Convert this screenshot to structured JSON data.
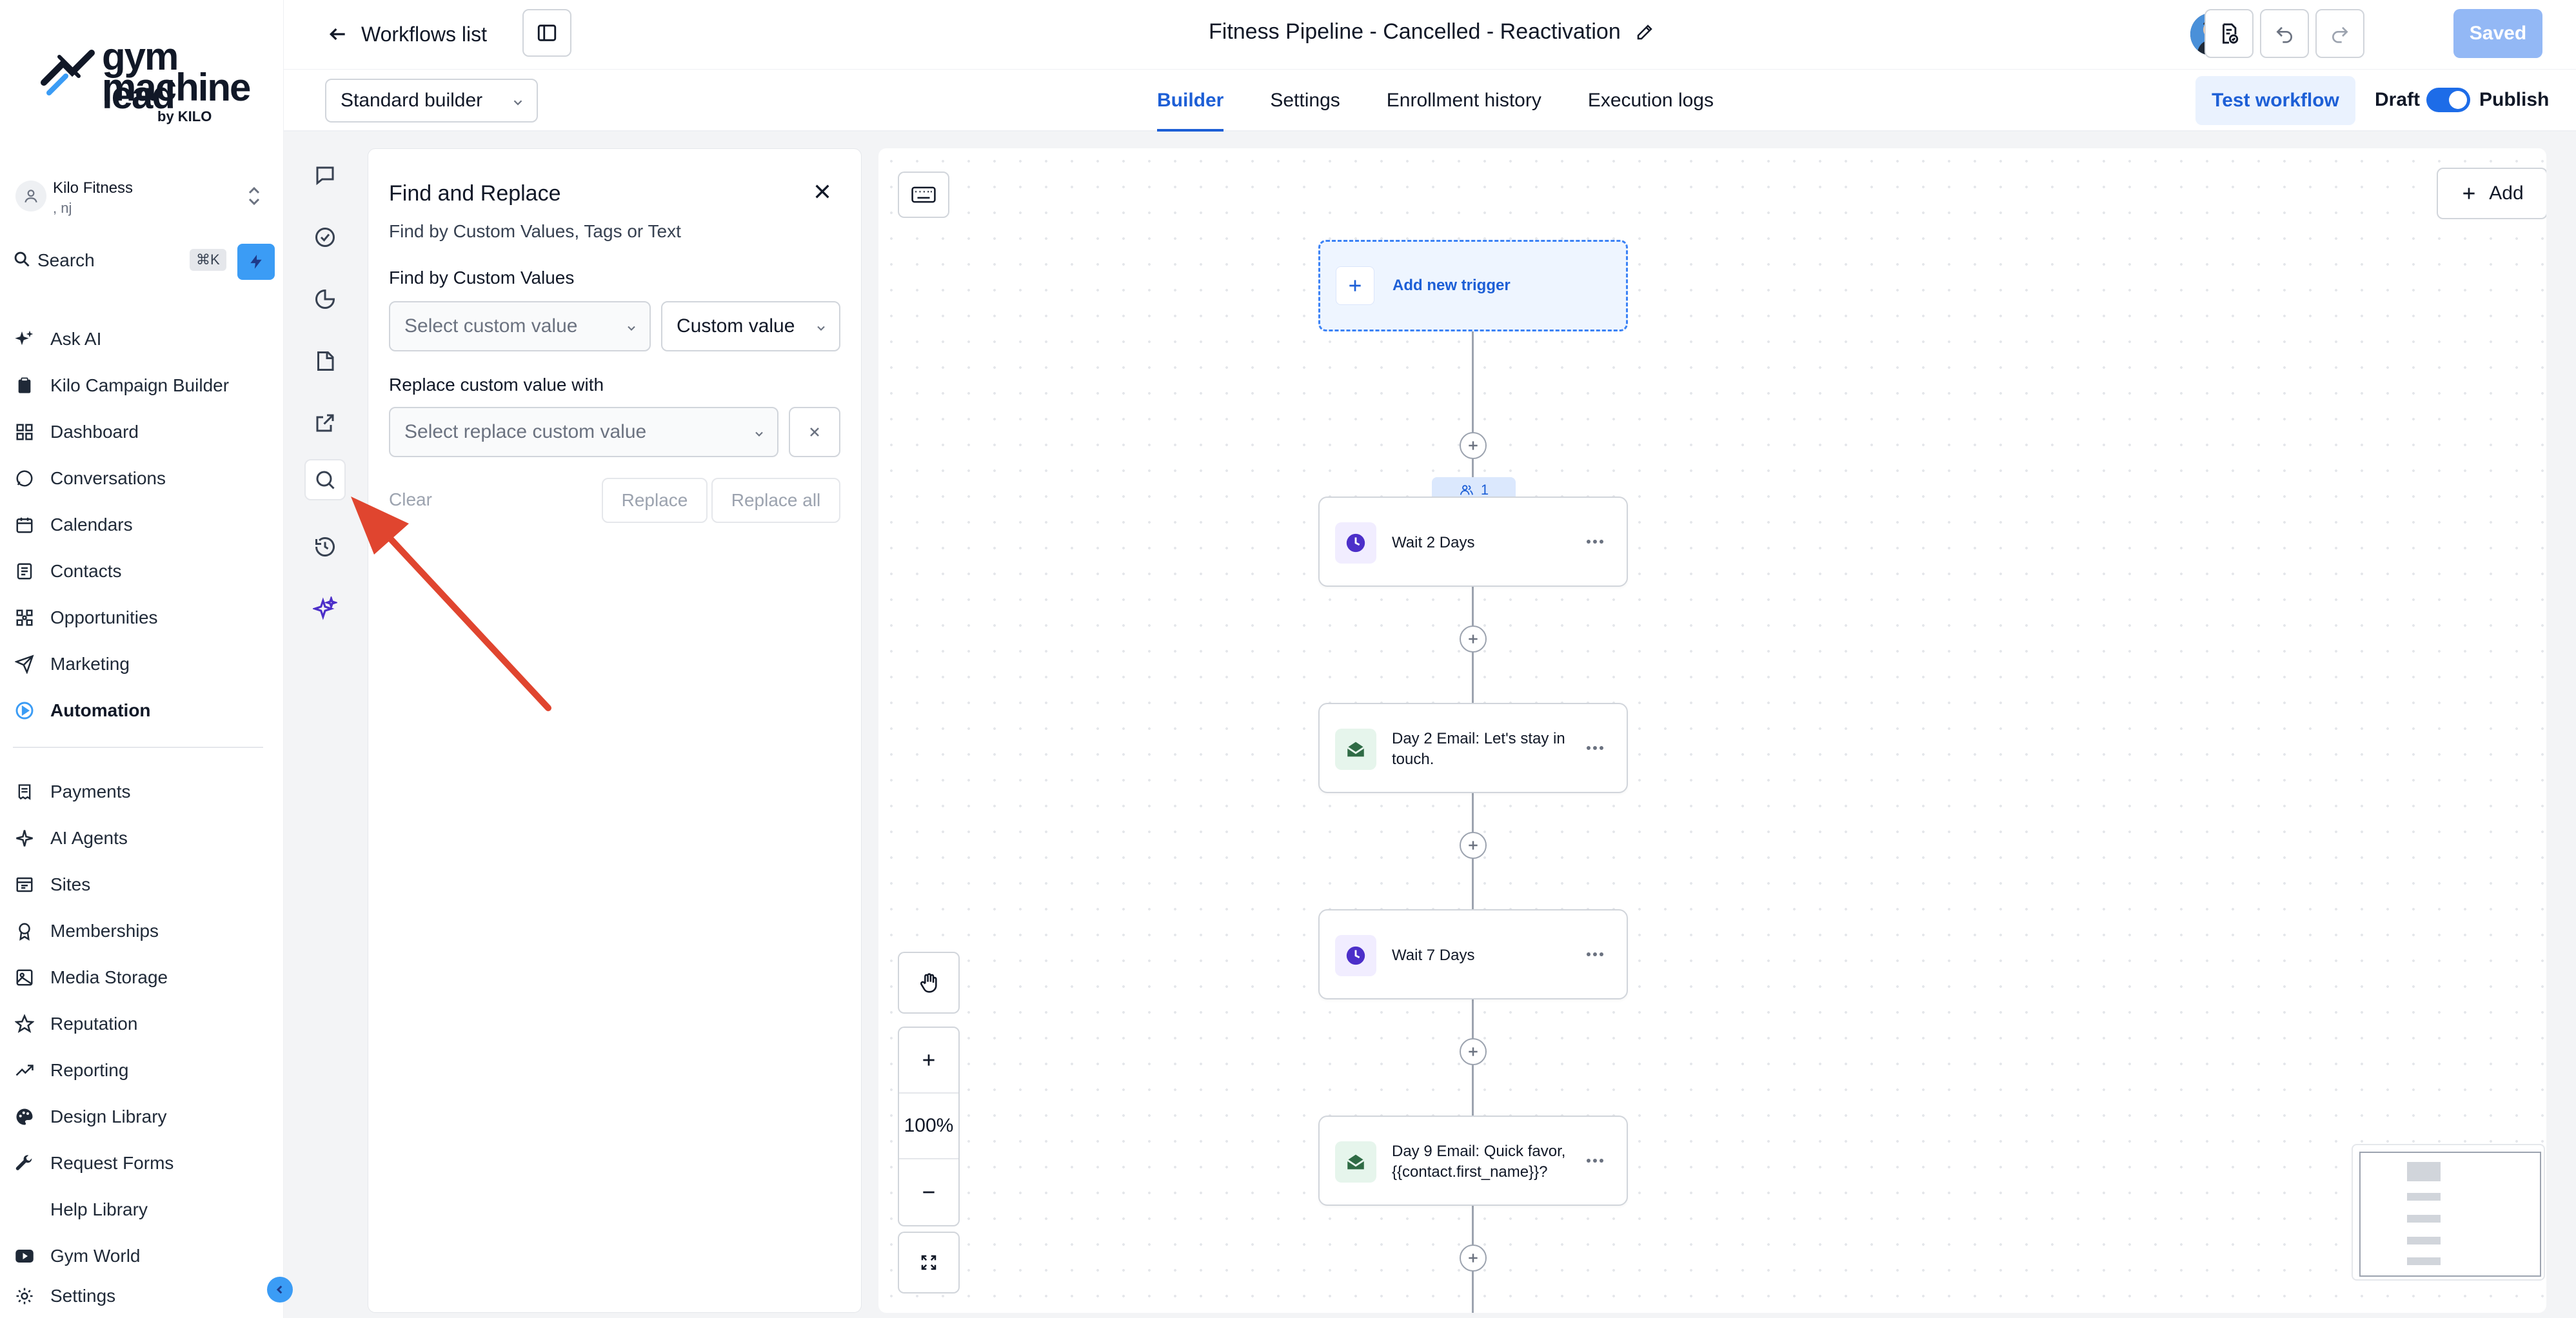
{
  "brand": {
    "line1": "gym lead",
    "line2": "machine",
    "byline": "by KILO"
  },
  "account": {
    "name": "Kilo Fitness",
    "sub": ", nj"
  },
  "search": {
    "label": "Search",
    "shortcut": "⌘K"
  },
  "nav": {
    "primary": [
      {
        "label": "Ask AI",
        "icon": "sparkles-icon"
      },
      {
        "label": "Kilo Campaign Builder",
        "icon": "clipboard-icon"
      },
      {
        "label": "Dashboard",
        "icon": "grid-icon"
      },
      {
        "label": "Conversations",
        "icon": "chat-bubble-icon"
      },
      {
        "label": "Calendars",
        "icon": "calendar-icon"
      },
      {
        "label": "Contacts",
        "icon": "contacts-icon"
      },
      {
        "label": "Opportunities",
        "icon": "opportunities-icon"
      },
      {
        "label": "Marketing",
        "icon": "send-icon"
      },
      {
        "label": "Automation",
        "icon": "automation-icon",
        "active": true
      }
    ],
    "secondary": [
      {
        "label": "Payments",
        "icon": "receipt-icon"
      },
      {
        "label": "AI Agents",
        "icon": "ai-agent-icon"
      },
      {
        "label": "Sites",
        "icon": "sites-icon"
      },
      {
        "label": "Memberships",
        "icon": "membership-icon"
      },
      {
        "label": "Media Storage",
        "icon": "image-icon"
      },
      {
        "label": "Reputation",
        "icon": "star-icon"
      },
      {
        "label": "Reporting",
        "icon": "trend-icon"
      },
      {
        "label": "Design Library",
        "icon": "palette-icon"
      },
      {
        "label": "Request Forms",
        "icon": "wrench-icon"
      },
      {
        "label": "Help Library",
        "icon": ""
      },
      {
        "label": "Gym World",
        "icon": "youtube-icon"
      },
      {
        "label": "Settings",
        "icon": "gear-icon"
      }
    ]
  },
  "header": {
    "back_label": "Workflows list",
    "title": "Fitness Pipeline - Cancelled - Reactivation",
    "saved_label": "Saved"
  },
  "subbar": {
    "builder_mode": "Standard builder",
    "tabs": [
      "Builder",
      "Settings",
      "Enrollment history",
      "Execution logs"
    ],
    "active_tab": "Builder",
    "test_label": "Test workflow",
    "draft_label": "Draft",
    "publish_label": "Publish"
  },
  "find_replace": {
    "title": "Find and Replace",
    "subtitle": "Find by Custom Values, Tags or Text",
    "find_label": "Find by Custom Values",
    "find_placeholder": "Select custom value",
    "type_value": "Custom value",
    "replace_label": "Replace custom value with",
    "replace_placeholder": "Select replace custom value",
    "clear_label": "Clear",
    "replace_btn": "Replace",
    "replace_all_btn": "Replace all"
  },
  "canvas": {
    "add_label": "Add",
    "trigger_label": "Add new trigger",
    "enrolled_count": "1",
    "zoom": "100%",
    "steps": [
      {
        "type": "wait",
        "label": "Wait 2 Days"
      },
      {
        "type": "email",
        "label": "Day 2 Email: Let's stay in touch."
      },
      {
        "type": "wait",
        "label": "Wait 7 Days"
      },
      {
        "type": "email",
        "label": "Day 9 Email: Quick favor, {{contact.first_name}}?"
      }
    ]
  },
  "colors": {
    "accent": "#1d5fd6",
    "annotation_arrow": "#e0452f",
    "wait_icon": "#4c2fc9",
    "email_icon": "#2f6b45"
  }
}
